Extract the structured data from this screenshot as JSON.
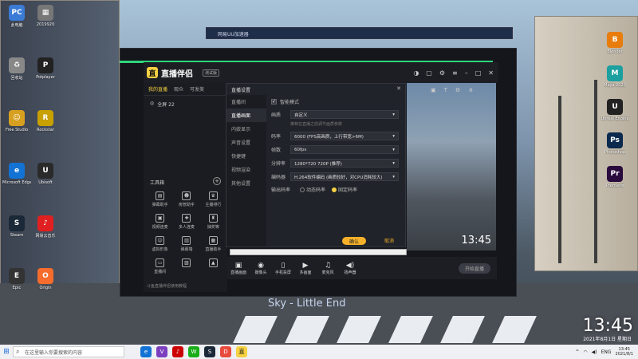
{
  "desktop": {
    "song_title": "Sky - Little End",
    "clock_time": "13:45",
    "clock_date": "2021年8月1日  星期日",
    "icons": [
      {
        "label": "此电脑",
        "color": "#3a7bd5",
        "glyph": "PC",
        "icon": "computer-icon"
      },
      {
        "label": "2019920",
        "color": "#777777",
        "glyph": "▦",
        "icon": "folder-icon"
      },
      {
        "label": "回收站",
        "color": "#888888",
        "glyph": "♻",
        "icon": "recycle-bin-icon"
      },
      {
        "label": "Potplayer",
        "color": "#222222",
        "glyph": "P",
        "icon": "potplayer-icon"
      },
      {
        "label": "Free Studio",
        "color": "#d8a020",
        "glyph": "☺",
        "icon": "free-studio-icon"
      },
      {
        "label": "Rockstar",
        "color": "#c8a000",
        "glyph": "R",
        "icon": "rockstar-icon"
      },
      {
        "label": "Microsoft Edge",
        "color": "#1273d4",
        "glyph": "e",
        "icon": "edge-icon"
      },
      {
        "label": "Ubisoft",
        "color": "#2a2a2a",
        "glyph": "U",
        "icon": "ubisoft-icon"
      },
      {
        "label": "Steam",
        "color": "#1b2838",
        "glyph": "S",
        "icon": "steam-icon"
      },
      {
        "label": "网易云音乐",
        "color": "#e02020",
        "glyph": "♪",
        "icon": "netease-music-icon"
      },
      {
        "label": "Epic",
        "color": "#333333",
        "glyph": "E",
        "icon": "epic-icon"
      },
      {
        "label": "Origin",
        "color": "#f56c2d",
        "glyph": "O",
        "icon": "origin-icon"
      }
    ],
    "right_icons": [
      {
        "label": "Blender",
        "color": "#e87d0d",
        "glyph": "B",
        "icon": "blender-icon"
      },
      {
        "label": "Maya 2020",
        "color": "#1c9f9f",
        "glyph": "M",
        "icon": "maya-icon"
      },
      {
        "label": "Unreal Engine",
        "color": "#222222",
        "glyph": "U",
        "icon": "unreal-icon"
      },
      {
        "label": "Photoshop",
        "color": "#0b2a4d",
        "glyph": "Ps",
        "icon": "photoshop-icon"
      },
      {
        "label": "Premiere",
        "color": "#2a0b3d",
        "glyph": "Pr",
        "icon": "premiere-icon"
      }
    ]
  },
  "backwindow": {
    "title": "网易UU加速器"
  },
  "app": {
    "name": "直播伴侣",
    "version_tag": "测试版",
    "left_tabs": [
      "我的直播",
      "观众",
      "可发美"
    ],
    "scene_label": "全屏 22",
    "tools_heading": "工具箱",
    "tools": [
      {
        "label": "弹幕助手",
        "glyph": "▤",
        "icon": "danmu-icon"
      },
      {
        "label": "房管助手",
        "glyph": "☻",
        "icon": "admin-icon"
      },
      {
        "label": "主播排行",
        "glyph": "♛",
        "icon": "rank-icon"
      },
      {
        "label": "视频连麦",
        "glyph": "▣",
        "icon": "video-link-icon"
      },
      {
        "label": "多人连麦",
        "glyph": "✚",
        "icon": "multi-link-icon"
      },
      {
        "label": "抽奖等",
        "glyph": "♜",
        "icon": "lottery-icon"
      },
      {
        "label": "虚拟形象",
        "glyph": "☺",
        "icon": "avatar-icon"
      },
      {
        "label": "弹幕墙",
        "glyph": "▥",
        "icon": "danmu-wall-icon"
      },
      {
        "label": "直播助手",
        "glyph": "▦",
        "icon": "live-assistant-icon"
      },
      {
        "label": "直播间",
        "glyph": "▭",
        "icon": "live-room-icon"
      },
      {
        "label": "",
        "glyph": "▧",
        "icon": "tool-icon"
      },
      {
        "label": "",
        "glyph": "▲",
        "icon": "tool2-icon"
      }
    ],
    "footer": "斗鱼直播伴侣使用教程"
  },
  "settings": {
    "title": "直播设置",
    "nav": [
      "直播间",
      "直播画面",
      "内嵌显示",
      "声音设置",
      "快捷键",
      "视频渲染",
      "其他设置"
    ],
    "active_nav": 1,
    "hw_accel_label": "智能模式",
    "rows": [
      {
        "label": "画质",
        "value": "自定义"
      },
      {
        "label": "码率",
        "value": "6000 (FPS高画质，上行带宽>6M)"
      },
      {
        "label": "帧数",
        "value": "60fps"
      },
      {
        "label": "分辨率",
        "value": "1280*720 720P (推荐)"
      },
      {
        "label": "编码器",
        "value": "H.264软件编码 (画质较好，对CPU消耗较大)"
      }
    ],
    "hint": "推荐在直播之前调节画质参数",
    "output_mode_label": "输出码率",
    "radio_a": "动态码率",
    "radio_b": "固定码率",
    "ok": "确认",
    "cancel": "取消"
  },
  "bottombar": {
    "items": [
      {
        "label": "直播画面",
        "glyph": "▣",
        "icon": "screen-icon"
      },
      {
        "label": "摄像头",
        "glyph": "◉",
        "icon": "camera-icon"
      },
      {
        "label": "手机投屏",
        "glyph": "▯",
        "icon": "phone-icon"
      },
      {
        "label": "多画面",
        "glyph": "▶",
        "icon": "multi-screen-icon"
      },
      {
        "label": "麦克风",
        "glyph": "♫",
        "icon": "mic-icon"
      },
      {
        "label": "扬声器",
        "glyph": "◀)",
        "icon": "speaker-icon"
      }
    ],
    "start_label": "开始直播"
  },
  "taskbar": {
    "search_placeholder": "在这里输入你要搜索的内容",
    "time": "13:45",
    "date": "2021/8/1",
    "lang": "ENG"
  }
}
